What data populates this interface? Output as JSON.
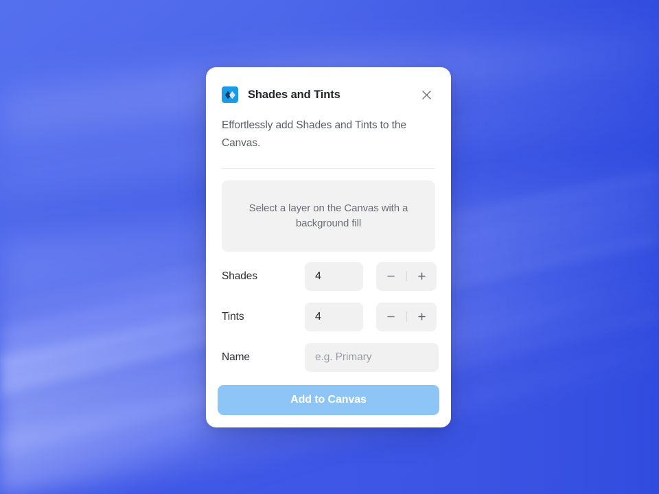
{
  "wallpaper": {
    "base_color": "#4a63e8",
    "deep_color": "#2f4fe0",
    "highlight_color": "#8e9df4"
  },
  "dialog": {
    "icon_name": "shades-and-tints-app-icon",
    "icon_bg": "#1b9be6",
    "title": "Shades and Tints",
    "close_label": "×",
    "description": "Effortlessly add Shades and Tints to the Canvas.",
    "hint": "Select a layer on the Canvas with a background fill",
    "fields": [
      {
        "label": "Shades",
        "value": "4",
        "decrement_label": "−",
        "increment_label": "+"
      },
      {
        "label": "Tints",
        "value": "4",
        "decrement_label": "−",
        "increment_label": "+"
      }
    ],
    "name_field": {
      "label": "Name",
      "value": "",
      "placeholder": "e.g. Primary"
    },
    "primary_button": {
      "label": "Add to Canvas",
      "color": "#8dc5f7"
    }
  }
}
